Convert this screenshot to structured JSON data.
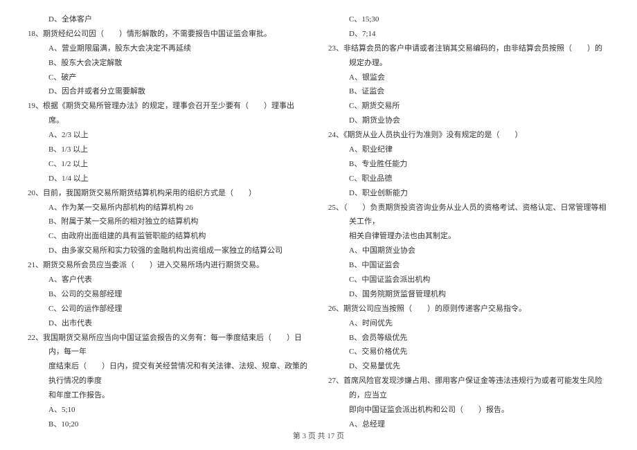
{
  "left": {
    "option_d_17": "D、全体客户",
    "q18": "18、期货经纪公司因（　　）情形解散的，不需要报告中国证监会审批。",
    "q18_a": "A、营业期限届满，股东大会决定不再延续",
    "q18_b": "B、股东大会决定解散",
    "q18_c": "C、破产",
    "q18_d": "D、因合并或者分立需要解散",
    "q19": "19、根据《期货交易所管理办法》的规定，理事会召开至少要有（　　）理事出席。",
    "q19_a": "A、2/3 以上",
    "q19_b": "B、1/3 以上",
    "q19_c": "C、1/2 以上",
    "q19_d": "D、1/4 以上",
    "q20": "20、目前，我国期货交易所期货结算机构采用的组织方式是（　　）",
    "q20_a": "A、作为某一交易所内部机构的结算机构 26",
    "q20_b": "B、附属于某一交易所的相对独立的结算机构",
    "q20_c": "C、由政府出面组建的具有监管职能的结算机构",
    "q20_d": "D、由多家交易所和实力较强的金融机构出资组成一家独立的结算公司",
    "q21": "21、期货交易所会员应当委派（　　）进入交易所场内进行期货交易。",
    "q21_a": "A、客户代表",
    "q21_b": "B、公司的交易部经理",
    "q21_c": "C、公司的运作部经理",
    "q21_d": "D、出市代表",
    "q22_1": "22、我国期货交易所应当向中国证监会报告的义务有：每一季度结束后（　　）日内，每一年",
    "q22_2": "度结束后（　　）日内，提交有关经营情况和有关法律、法规、规章、政策的执行情况的季度",
    "q22_3": "和年度工作报告。",
    "q22_a": "A、5;10",
    "q22_b": "B、10;20"
  },
  "right": {
    "q22_c": "C、15;30",
    "q22_d": "D、7;14",
    "q23": "23、非结算会员的客户申请或者注销其交易编码的，由非结算会员按照（　　）的规定办理。",
    "q23_a": "A、银监会",
    "q23_b": "B、证监会",
    "q23_c": "C、期货交易所",
    "q23_d": "D、期货业协会",
    "q24": "24、《期货从业人员执业行为准则》没有规定的是（　　）",
    "q24_a": "A、职业纪律",
    "q24_b": "B、专业胜任能力",
    "q24_c": "C、职业品德",
    "q24_d": "D、职业创新能力",
    "q25_1": "25、（　　）负责期货投资咨询业务从业人员的资格考试、资格认定、日常管理等相关工作，",
    "q25_2": "相关自律管理办法也由其制定。",
    "q25_a": "A、中国期货业协会",
    "q25_b": "B、中国证监会",
    "q25_c": "C、中国证监会派出机构",
    "q25_d": "D、国务院期货监督管理机构",
    "q26": "26、期货公司应当按照（　　）的原则传递客户交易指令。",
    "q26_a": "A、时间优先",
    "q26_b": "B、会员等级优先",
    "q26_c": "C、交易价格优先",
    "q26_d": "D、交易量优先",
    "q27_1": "27、首席风险官发现涉嫌占用、挪用客户保证金等违法违规行为或者可能发生风险的，应当立",
    "q27_2": "即向中国证监会派出机构和公司（　　）报告。",
    "q27_a": "A、总经理"
  },
  "footer": "第 3 页 共 17 页"
}
